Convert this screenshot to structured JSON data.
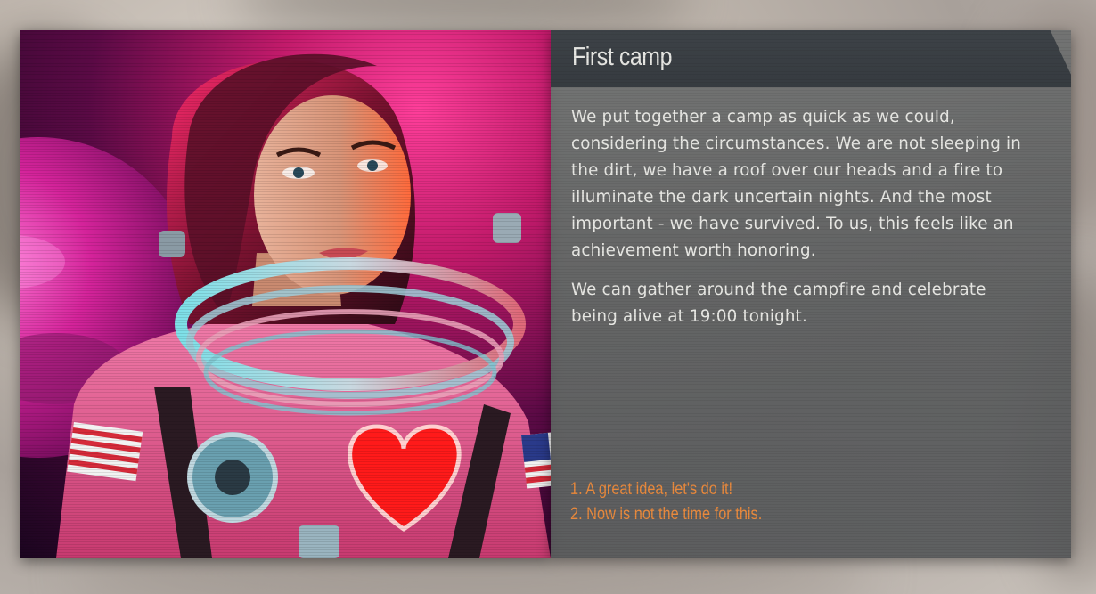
{
  "dialog": {
    "title": "First camp",
    "paragraphs": [
      "We put together a camp as quick as we could, considering the circumstances. We are not sleeping in the dirt, we have a roof over our heads and a fire to illuminate the dark uncertain nights. And the most important - we have survived. To us, this feels like an achievement worth honoring.",
      "We can gather around the campfire and celebrate being alive at 19:00 tonight."
    ],
    "choices": [
      {
        "number": "1.",
        "label": "A great idea, let's do it!"
      },
      {
        "number": "2.",
        "label": "Now is not the time for this."
      }
    ]
  },
  "colors": {
    "choice_text": "#e98a3e",
    "title_bar": "#3d4247",
    "panel": "#5f6163"
  }
}
